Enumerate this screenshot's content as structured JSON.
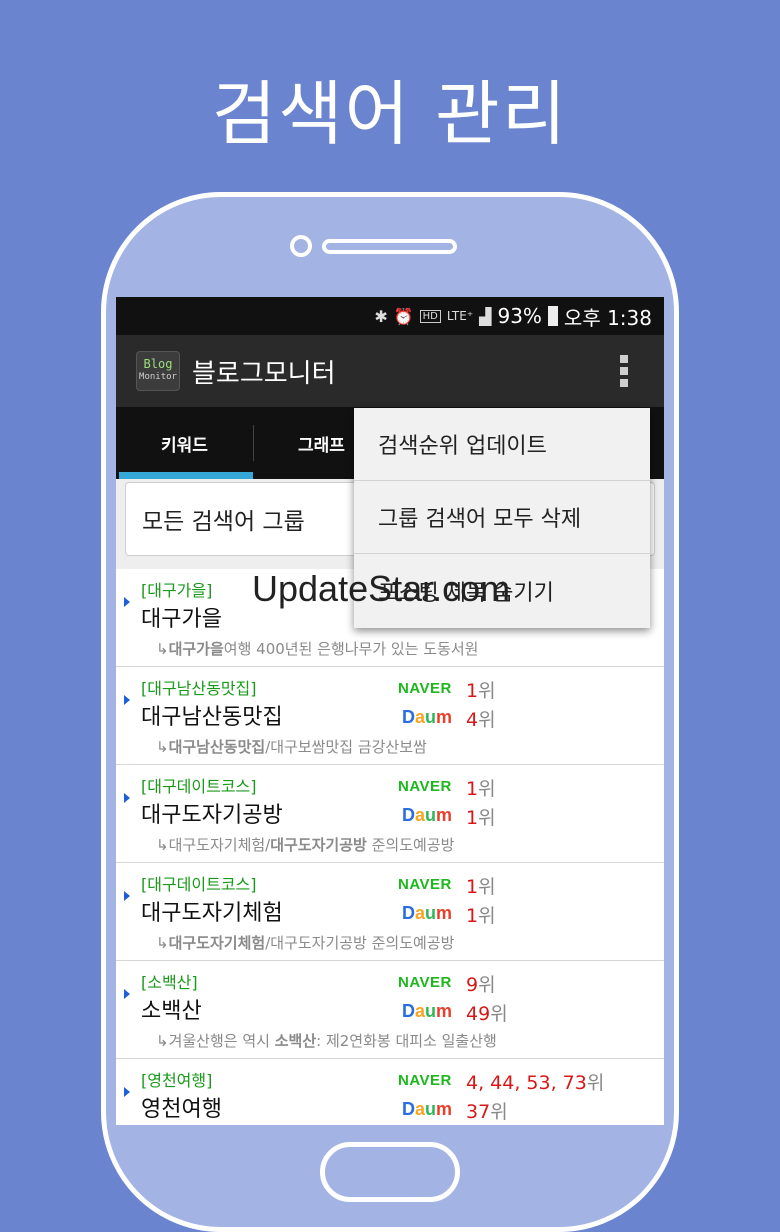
{
  "headline": "검색어 관리",
  "status_bar": {
    "icons": [
      "bluetooth-icon",
      "alarm-icon",
      "hd-icon",
      "lte-icon",
      "signal-icon",
      "battery-icon"
    ],
    "battery": "93%",
    "time": "오후 1:38"
  },
  "app_bar": {
    "logo_line1": "Blog",
    "logo_line2": "Monitor",
    "title": "블로그모니터"
  },
  "tabs": [
    {
      "label": "키워드"
    },
    {
      "label": "그래프"
    }
  ],
  "group_select": {
    "value": "모든 검색어 그룹"
  },
  "menu": {
    "items": [
      "검색순위 업데이트",
      "그룹 검색어 모두 삭제",
      "포스팅 제목 숨기기"
    ]
  },
  "watermark": "UpdateStar.com",
  "engines": {
    "naver": "NAVER",
    "daum_d": "D",
    "daum_a": "a",
    "daum_u": "u",
    "daum_m": "m"
  },
  "rank_suffix": "위",
  "keywords": [
    {
      "group": "[대구가을]",
      "keyword": "대구가을",
      "sub_prefix": "↳",
      "sub_bold": "대구가을",
      "sub_rest": "여행 400년된 은행나무가 있는 도동서원",
      "naver": "",
      "daum": ""
    },
    {
      "group": "[대구남산동맛집]",
      "keyword": "대구남산동맛집",
      "sub_prefix": "↳",
      "sub_bold": "대구남산동맛집",
      "sub_rest": "/대구보쌈맛집 금강산보쌈",
      "naver": "1",
      "daum": "4"
    },
    {
      "group": "[대구데이트코스]",
      "keyword": "대구도자기공방",
      "sub_prefix": "↳",
      "sub_plain": "대구도자기체험/",
      "sub_bold": "대구도자기공방",
      "sub_rest": " 준의도예공방",
      "naver": "1",
      "daum": "1"
    },
    {
      "group": "[대구데이트코스]",
      "keyword": "대구도자기체험",
      "sub_prefix": "↳",
      "sub_bold": "대구도자기체험",
      "sub_rest": "/대구도자기공방 준의도예공방",
      "naver": "1",
      "daum": "1"
    },
    {
      "group": "[소백산]",
      "keyword": "소백산",
      "sub_prefix": "↳",
      "sub_plain": "겨울산행은 역시 ",
      "sub_bold": "소백산",
      "sub_rest": ": 제2연화봉 대피소 일출산행",
      "naver": "9",
      "daum": "49"
    },
    {
      "group": "[영천여행]",
      "keyword": "영천여행",
      "sub_prefix": "",
      "sub_bold": "",
      "sub_rest": "",
      "naver": "4, 44, 53, 73",
      "daum": "37"
    }
  ],
  "colors": {
    "background": "#6b84cf",
    "tab_indicator": "#35a8d8",
    "group_text": "#1a9a1a",
    "rank_number": "#d81818",
    "naver_green": "#1db81d"
  }
}
